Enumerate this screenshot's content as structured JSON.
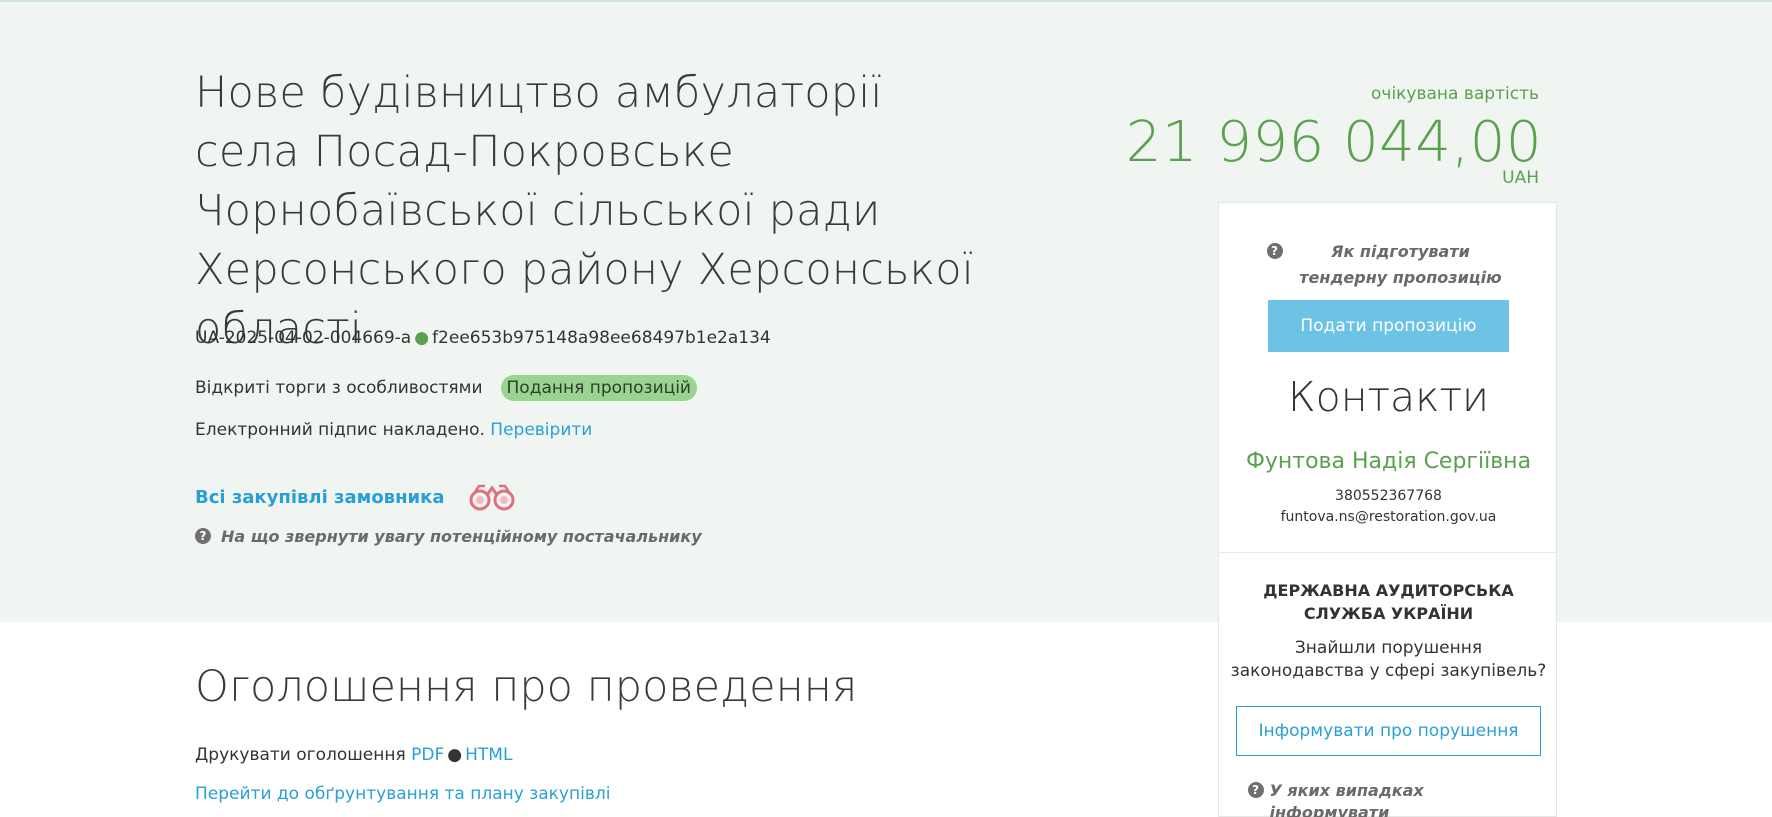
{
  "tender": {
    "title": "Нове будівництво амбулаторії села Посад-Покровське Чорнобаївської сільської ради Херсонського району Херсонської області",
    "id": "UA-2025-04-02-004669-a",
    "hash": "f2ee653b975148a98ee68497b1e2a134",
    "procedure_type": "Відкриті торги з особливостями",
    "status": "Подання пропозицій",
    "signature_text": "Електронний підпис накладено.",
    "signature_link": "Перевірити",
    "buyer_link": "Всі закупівлі замовника",
    "supplier_hint": "На що звернути увагу потенційному постачальнику"
  },
  "value": {
    "label": "очікувана вартість",
    "amount": "21 996 044,00",
    "currency": "UAH"
  },
  "panel": {
    "hint": "Як підготувати тендерну пропозицію",
    "submit_label": "Подати пропозицію",
    "contacts_title": "Контакти",
    "contact_name": "Фунтова Надія Сергіївна",
    "contact_phone": "380552367768",
    "contact_email": "funtova.ns@restoration.gov.ua",
    "audit_title": "ДЕРЖАВНА АУДИТОРСЬКА СЛУЖБА УКРАЇНИ",
    "audit_text": "Знайшли порушення законодавства у сфері закупівель?",
    "inform_label": "Інформувати про порушення",
    "audit_hint": "У яких випадках інформувати Держаудитслужбу"
  },
  "announcement": {
    "title": "Оголошення про проведення",
    "print_label": "Друкувати оголошення",
    "pdf": "PDF",
    "html": "HTML",
    "plan_link": "Перейти до обґрунтування та плану закупівлі"
  },
  "colors": {
    "accent_green": "#5aa14f",
    "link_blue": "#2a9fd6",
    "button_blue": "#6cc3e6",
    "status_badge": "#99d590",
    "hero_bg": "#f1f5f2"
  },
  "icons": {
    "help": "question-circle-icon",
    "buyer": "binoculars-icon"
  }
}
